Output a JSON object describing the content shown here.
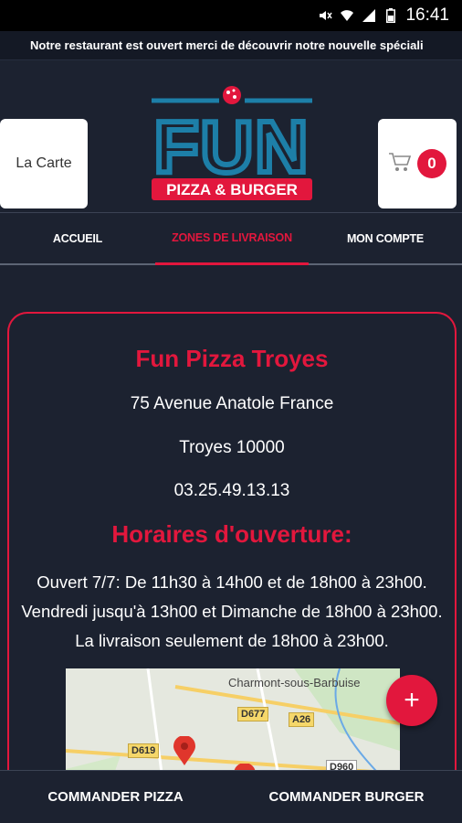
{
  "status_bar": {
    "time": "16:41"
  },
  "marquee": {
    "text": "Notre restaurant est ouvert merci de découvrir notre nouvelle spéciali"
  },
  "header": {
    "carte_label": "La Carte",
    "cart_count": "0",
    "logo": {
      "main": "FUN",
      "sub": "PIZZA & BURGER"
    }
  },
  "nav": {
    "items": [
      "ACCUEIL",
      "ZONES DE LIVRAISON",
      "MON COMPTE"
    ],
    "active": "ZONES DE LIVRAISON"
  },
  "restaurant": {
    "name": "Fun Pizza Troyes",
    "address": "75 Avenue Anatole France",
    "city": "Troyes 10000",
    "phone": "03.25.49.13.13",
    "hours_title": "Horaires d'ouverture:",
    "hours_text": "Ouvert 7/7: De 11h30 à 14h00 et de 18h00 à 23h00. Vendredi jusqu'à 13h00 et Dimanche de 18h00 à 23h00. La livraison seulement de 18h00 à 23h00."
  },
  "map": {
    "place": "Charmont-sous-Barbuise",
    "roads": [
      "D677",
      "A26",
      "D619",
      "D960"
    ]
  },
  "fab": {
    "symbol": "+"
  },
  "bottom": {
    "pizza_label": "COMMANDER PIZZA",
    "burger_label": "COMMANDER BURGER"
  },
  "colors": {
    "accent": "#e2173d",
    "background": "#1c2230",
    "logo_blue": "#1d7fa8"
  }
}
